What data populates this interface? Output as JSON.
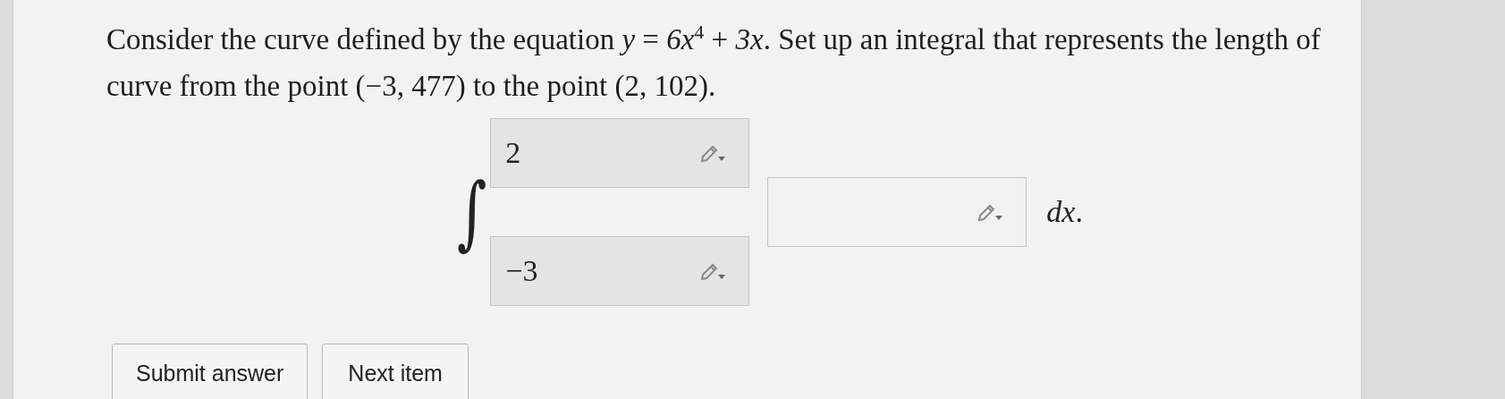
{
  "question": "Consider the curve defined by the equation *y* = *6x*$^{4}$ + *3x*. Set up an integral that represents the length of curve from the point (−3, 477) to the point (2, 102).",
  "integral": {
    "symbol": "∫",
    "upper_limit": "2",
    "lower_limit": "−3",
    "differential": "*dx*."
  },
  "buttons": [
    {
      "label": "Submit answer"
    },
    {
      "label": "Next item"
    }
  ]
}
